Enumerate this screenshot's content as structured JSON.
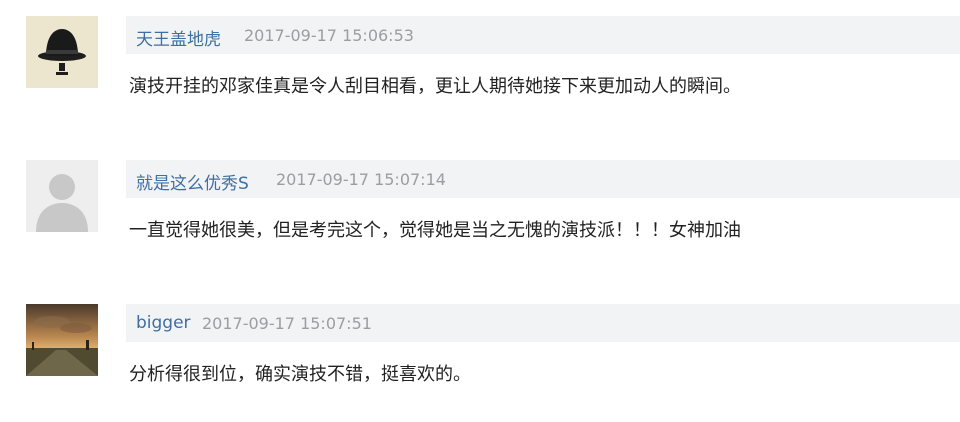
{
  "comments": [
    {
      "username": "天王盖地虎",
      "timestamp": "2017-09-17 15:06:53",
      "text": "演技开挂的邓家佳真是令人刮目相看，更让人期待她接下来更加动人的瞬间。",
      "avatar_icon": "bowler-hat-icon"
    },
    {
      "username": "就是这么优秀S",
      "timestamp": "2017-09-17 15:07:14",
      "text": "一直觉得她很美，但是考完这个，觉得她是当之无愧的演技派！！！女神加油",
      "avatar_icon": "default-user-icon"
    },
    {
      "username": "bigger",
      "timestamp": "2017-09-17 15:07:51",
      "text": "分析得很到位，确实演技不错，挺喜欢的。",
      "avatar_icon": "sunset-landscape-icon"
    }
  ],
  "colors": {
    "username": "#3f6ea0",
    "timestamp": "#9a9da2",
    "meta_bar_bg": "#f2f3f5",
    "text": "#222222"
  }
}
